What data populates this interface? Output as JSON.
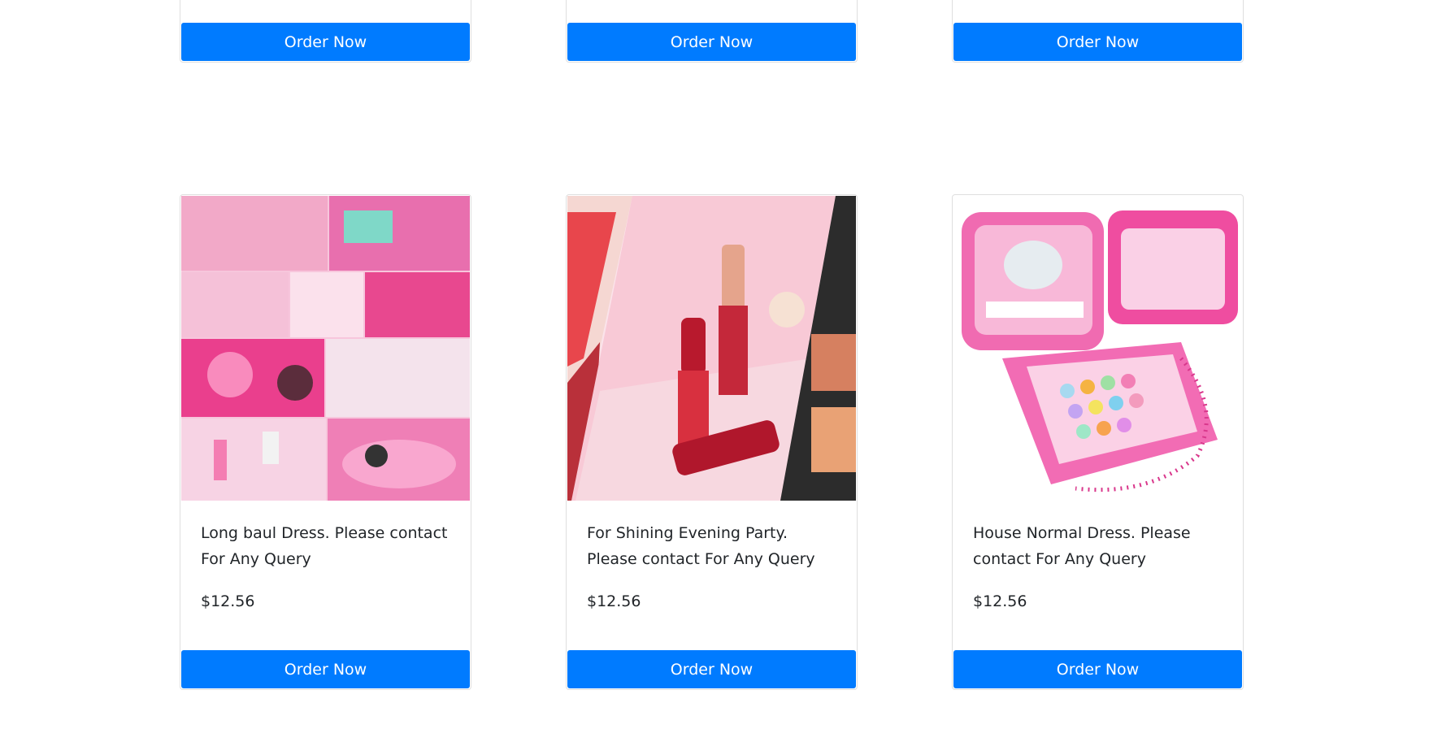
{
  "top_row": [
    {
      "button_label": "Order Now"
    },
    {
      "button_label": "Order Now"
    },
    {
      "button_label": "Order Now"
    }
  ],
  "products": [
    {
      "image": "pink-makeup-collage-image",
      "description": "Long baul Dress. Please contact For Any Query",
      "price": "$12.56",
      "button_label": "Order Now"
    },
    {
      "image": "red-lipsticks-image",
      "description": "For Shining Evening Party. Please contact For Any Query",
      "price": "$12.56",
      "button_label": "Order Now"
    },
    {
      "image": "pink-kids-makeup-kit-image",
      "description": "House Normal Dress. Please contact For Any Query",
      "price": "$12.56",
      "button_label": "Order Now"
    }
  ],
  "colors": {
    "button_bg": "#007bff",
    "button_text": "#ffffff",
    "card_border": "#dfdfdf",
    "text": "#212529"
  }
}
